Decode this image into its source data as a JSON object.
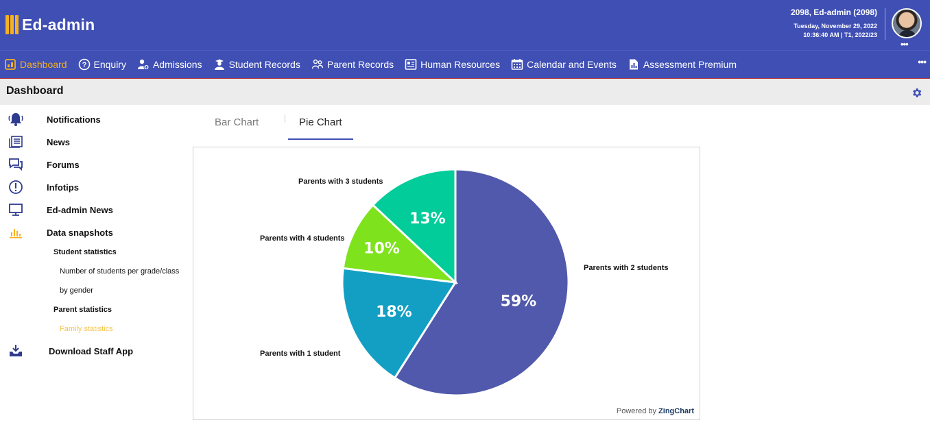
{
  "app": {
    "title": "Ed-admin",
    "user": "2098, Ed-admin (2098)",
    "date": "Tuesday, November 29, 2022",
    "time_term": "10:36:40 AM  |  T1, 2022/23",
    "more": "•••"
  },
  "nav": {
    "items": [
      {
        "label": "Dashboard",
        "icon": "dashboard-icon"
      },
      {
        "label": "Enquiry",
        "icon": "question-circle-icon"
      },
      {
        "label": "Admissions",
        "icon": "person-add-icon"
      },
      {
        "label": "Student Records",
        "icon": "student-icon"
      },
      {
        "label": "Parent Records",
        "icon": "parents-icon"
      },
      {
        "label": "Human Resources",
        "icon": "id-card-icon"
      },
      {
        "label": "Calendar and Events",
        "icon": "calendar-icon"
      },
      {
        "label": "Assessment Premium",
        "icon": "report-icon"
      }
    ],
    "more": "•••"
  },
  "page": {
    "title": "Dashboard"
  },
  "sidebar": {
    "items": [
      {
        "label": "Notifications",
        "icon": "bell-icon"
      },
      {
        "label": "News",
        "icon": "newspaper-icon"
      },
      {
        "label": "Forums",
        "icon": "chat-icon"
      },
      {
        "label": "Infotips",
        "icon": "exclamation-circle-icon"
      },
      {
        "label": "Ed-admin News",
        "icon": "monitor-icon"
      },
      {
        "label": "Data snapshots",
        "icon": "bar-chart-icon"
      }
    ],
    "sub": {
      "student_stats": "Student statistics",
      "students_per_grade": "Number of students per grade/class",
      "by_gender": "by gender",
      "parent_stats": "Parent statistics",
      "family_stats": "Family statistics"
    },
    "download": {
      "label": "Download Staff App",
      "icon": "download-tray-icon"
    }
  },
  "tabs": {
    "bar": "Bar Chart",
    "pie": "Pie Chart",
    "active": "Pie Chart"
  },
  "chart_data": {
    "type": "pie",
    "slices": [
      {
        "label": "Parents with 2 students",
        "value": 59,
        "display": "59%",
        "color": "#5059ab"
      },
      {
        "label": "Parents with 1 student",
        "value": 18,
        "display": "18%",
        "color": "#139fc4"
      },
      {
        "label": "Parents with 4 students",
        "value": 10,
        "display": "10%",
        "color": "#7ee21d"
      },
      {
        "label": "Parents with 3 students",
        "value": 13,
        "display": "13%",
        "color": "#02cc9a"
      }
    ],
    "powered_prefix": "Powered by",
    "powered_brand": "ZingChart"
  },
  "colors": {
    "header": "#3f4fb4",
    "accent": "#f6b11e"
  }
}
